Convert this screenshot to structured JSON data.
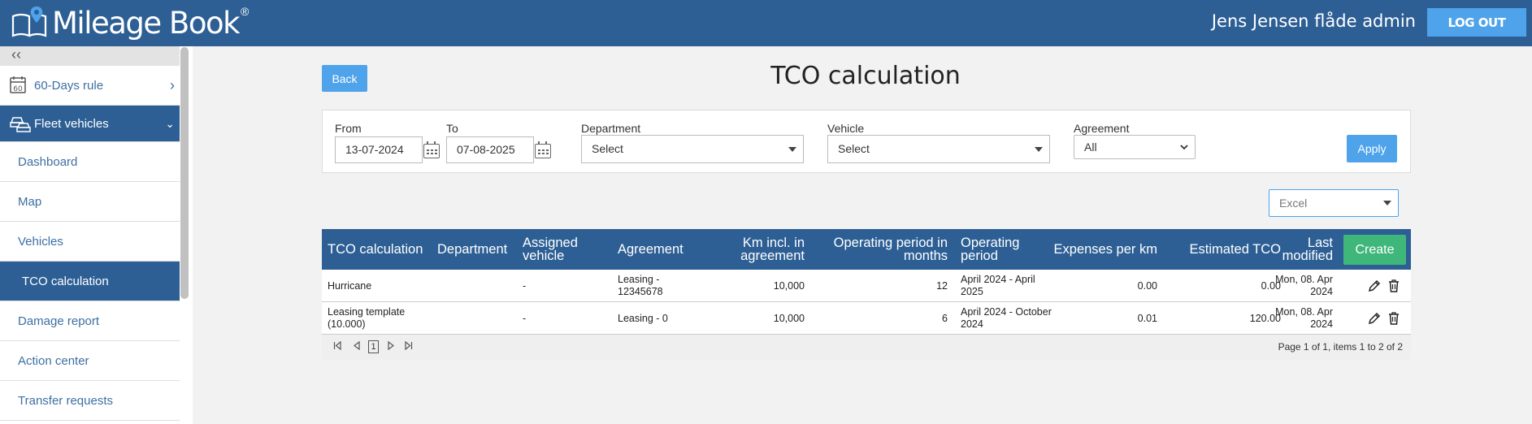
{
  "header": {
    "app_name": "Mileage Book",
    "reg_mark": "®",
    "user_name": "Jens Jensen flåde admin",
    "logout_label": "LOG OUT"
  },
  "sidebar": {
    "collapse_label": "‹‹",
    "items": [
      {
        "label": "60-Days rule"
      },
      {
        "label": "Fleet vehicles"
      },
      {
        "label": "Dashboard"
      },
      {
        "label": "Map"
      },
      {
        "label": "Vehicles"
      },
      {
        "label": "TCO calculation"
      },
      {
        "label": "Damage report"
      },
      {
        "label": "Action center"
      },
      {
        "label": "Transfer requests"
      }
    ],
    "calendar_badge": "60"
  },
  "page": {
    "title": "TCO calculation",
    "back_label": "Back"
  },
  "filters": {
    "from_label": "From",
    "from_value": "13-07-2024",
    "to_label": "To",
    "to_value": "07-08-2025",
    "department_label": "Department",
    "department_value": "Select",
    "vehicle_label": "Vehicle",
    "vehicle_value": "Select",
    "agreement_label": "Agreement",
    "agreement_value": "All",
    "apply_label": "Apply"
  },
  "export": {
    "selected": "Excel"
  },
  "table": {
    "columns": [
      "TCO calculation",
      "Department",
      "Assigned vehicle",
      "Agreement",
      "Km incl. in agreement",
      "Operating period in months",
      "Operating period",
      "Expenses per km",
      "Estimated TCO",
      "Last modified"
    ],
    "create_label": "Create",
    "rows": [
      {
        "name": "Hurricane",
        "department": "",
        "vehicle": "-",
        "agreement": "Leasing - 12345678",
        "km": "10,000",
        "months": "12",
        "period": "April 2024 - April 2025",
        "expenses": "0.00",
        "tco": "0.00",
        "modified": "Mon, 08. Apr 2024"
      },
      {
        "name": "Leasing template (10.000)",
        "department": "",
        "vehicle": "-",
        "agreement": "Leasing - 0",
        "km": "10,000",
        "months": "6",
        "period": "April 2024 - October 2024",
        "expenses": "0.01",
        "tco": "120.00",
        "modified": "Mon, 08. Apr 2024"
      }
    ],
    "pager": {
      "current_page": "1",
      "info": "Page 1 of 1, items 1 to 2 of 2"
    }
  },
  "colors": {
    "brand": "#2d5f95",
    "button": "#4fa3ea",
    "create": "#3fb77a"
  }
}
